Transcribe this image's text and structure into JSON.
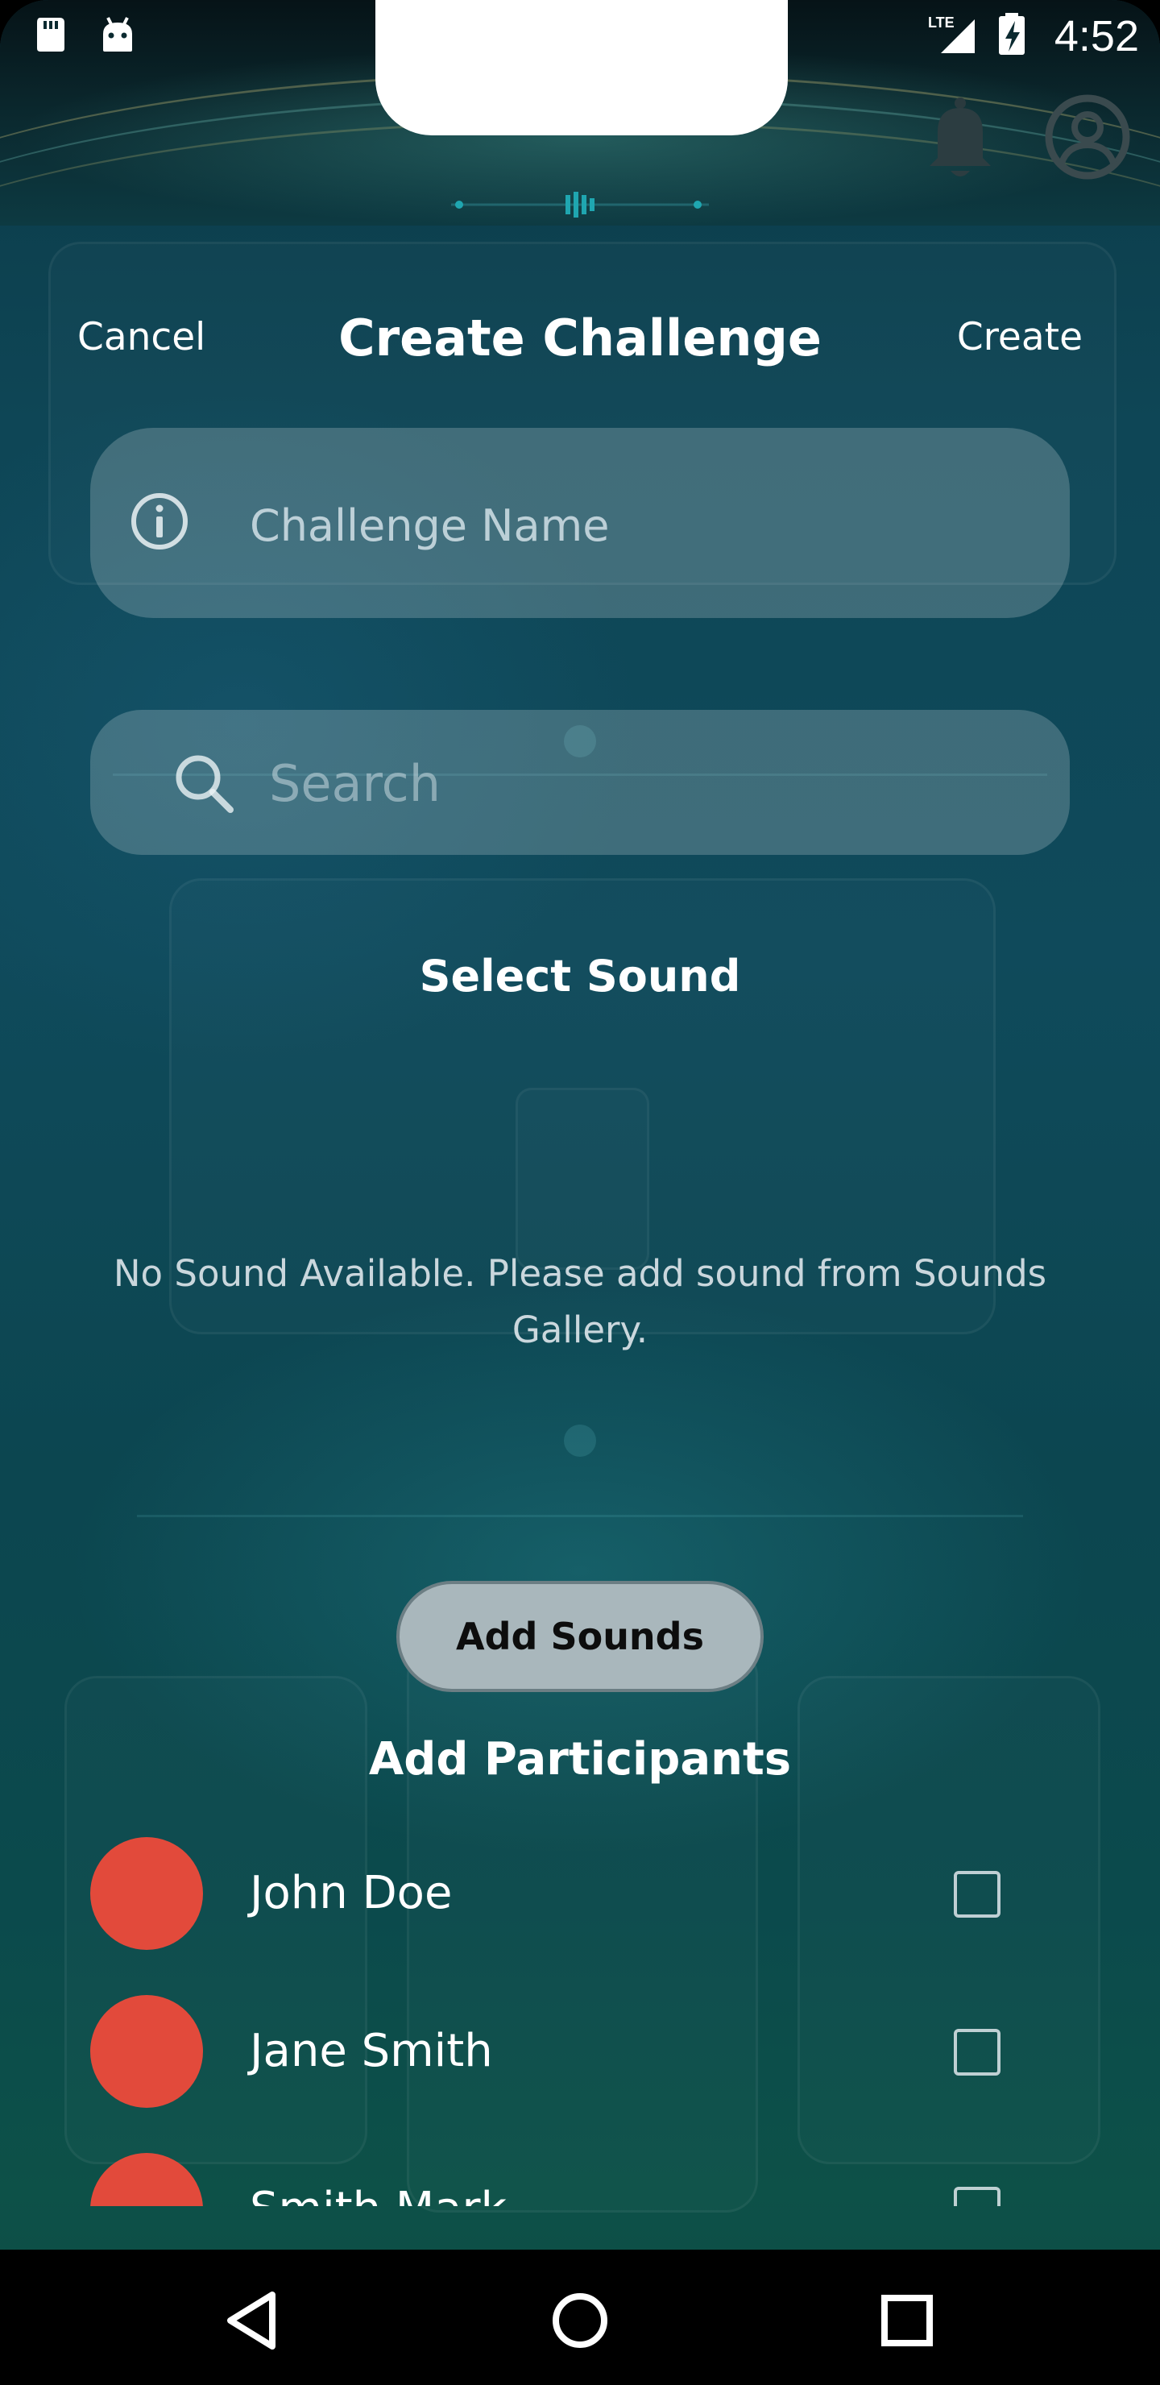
{
  "status_bar": {
    "time": "4:52",
    "network": "LTE"
  },
  "header": {
    "cancel_label": "Cancel",
    "title": "Create Challenge",
    "create_label": "Create"
  },
  "challenge_name": {
    "placeholder": "Challenge Name",
    "value": ""
  },
  "search": {
    "placeholder": "Search",
    "value": ""
  },
  "sound_section": {
    "title": "Select Sound",
    "empty_message": "No Sound Available. Please add sound from Sounds Gallery.",
    "add_button_label": "Add Sounds"
  },
  "participants_section": {
    "title": "Add Participants",
    "items": [
      {
        "name": "John Doe",
        "checked": false
      },
      {
        "name": "Jane Smith",
        "checked": false
      },
      {
        "name": "Smith Mark",
        "checked": false
      }
    ]
  },
  "colors": {
    "avatar": "#e24a3b",
    "add_sounds_button": "#a9b7bc"
  },
  "icons": {
    "top_right": [
      "bell-icon",
      "profile-icon"
    ],
    "nav": [
      "back-icon",
      "home-icon",
      "recents-icon"
    ]
  }
}
